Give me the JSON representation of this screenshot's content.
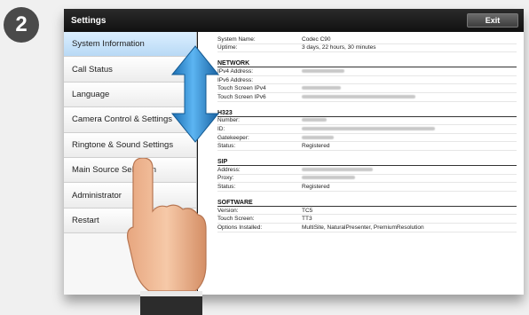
{
  "step_number": "2",
  "title": "Settings",
  "exit_label": "Exit",
  "sidebar": {
    "items": [
      {
        "label": "System Information",
        "active": true
      },
      {
        "label": "Call Status"
      },
      {
        "label": "Language"
      },
      {
        "label": "Camera Control & Settings"
      },
      {
        "label": "Ringtone & Sound Settings"
      },
      {
        "label": "Main Source Selection"
      },
      {
        "label": "Administrator"
      },
      {
        "label": "Restart"
      }
    ]
  },
  "info": {
    "system_name_label": "System Name:",
    "system_name_value": "Codec C90",
    "uptime_label": "Uptime:",
    "uptime_value": "3 days, 22 hours, 30 minutes"
  },
  "network": {
    "heading": "NETWORK",
    "ipv4_label": "IPv4 Address:",
    "ipv6_label": "IPv6 Address:",
    "touch_ipv4_label": "Touch Screen IPv4",
    "touch_ipv6_label": "Touch Screen IPv6"
  },
  "h323": {
    "heading": "H323",
    "number_label": "Number:",
    "id_label": "ID:",
    "gatekeeper_label": "Gatekeeper:",
    "status_label": "Status:",
    "status_value": "Registered"
  },
  "sip": {
    "heading": "SIP",
    "address_label": "Address:",
    "proxy_label": "Proxy:",
    "status_label": "Status:",
    "status_value": "Registered"
  },
  "software": {
    "heading": "SOFTWARE",
    "version_label": "Version:",
    "version_value": "TC5",
    "touch_label": "Touch Screen:",
    "touch_value": "TT3",
    "options_label": "Options Installed:",
    "options_value": "MultiSite, NaturalPresenter, PremiumResolution"
  },
  "colors": {
    "titlebar": "#1a1a1a",
    "sidebar_active": "#cfe6fb",
    "arrow": "#2f8fd6"
  }
}
